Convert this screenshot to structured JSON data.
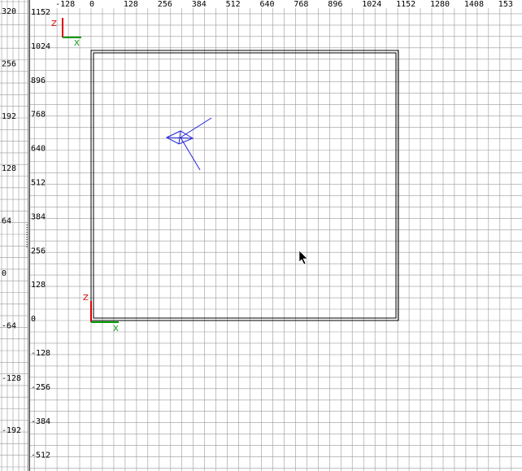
{
  "side_view": {
    "y_ticks": [
      "320",
      "256",
      "192",
      "128",
      "64",
      "0",
      "-64",
      "-128",
      "-192"
    ],
    "ticks_cut_off": [
      "-128"
    ]
  },
  "main_view": {
    "x_ticks": [
      "-128",
      "0",
      "128",
      "256",
      "384",
      "512",
      "640",
      "768",
      "896",
      "1024",
      "1152",
      "1280",
      "1408",
      "153"
    ],
    "y_ticks": [
      "1152",
      "1024",
      "896",
      "768",
      "640",
      "512",
      "384",
      "256",
      "128",
      "0",
      "-128",
      "-256",
      "-384",
      "-512"
    ],
    "axis_gizmo_top": {
      "z_label": "Z",
      "x_label": "X"
    },
    "axis_gizmo_origin": {
      "z_label": "Z",
      "x_label": "X"
    }
  },
  "colors": {
    "grid": "#9a9a9a",
    "background": "#ffffff",
    "brush_outline": "#000000",
    "entity": "#2222dd",
    "z_axis": "#dd0000",
    "x_axis": "#009900"
  },
  "icons": {
    "cursor": "arrow-cursor-icon"
  }
}
